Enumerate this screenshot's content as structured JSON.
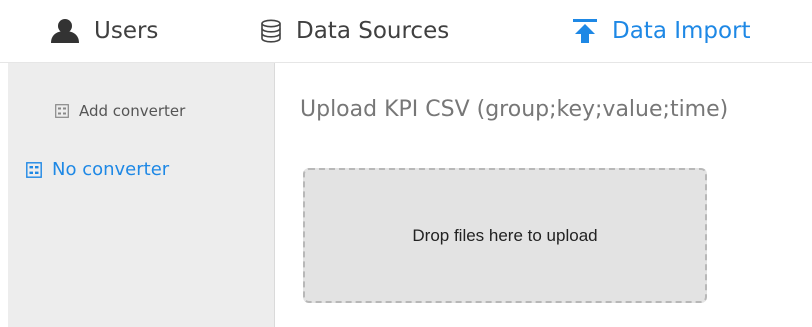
{
  "nav": {
    "tabs": [
      {
        "label": "Users",
        "icon": "user-icon"
      },
      {
        "label": "Data Sources",
        "icon": "database-icon"
      },
      {
        "label": "Data Import",
        "icon": "upload-icon",
        "active": true
      }
    ]
  },
  "sidebar": {
    "add_label": "Add converter",
    "add_icon": "converter-icon",
    "items": [
      {
        "label": "No converter",
        "icon": "converter-icon",
        "selected": true
      }
    ]
  },
  "main": {
    "title": "Upload KPI CSV (group;key;value;time)",
    "dropzone_text": "Drop files here to upload"
  },
  "colors": {
    "accent": "#1e88e5",
    "sidebar_bg": "#ededed",
    "dropzone_bg": "#e3e3e3"
  }
}
